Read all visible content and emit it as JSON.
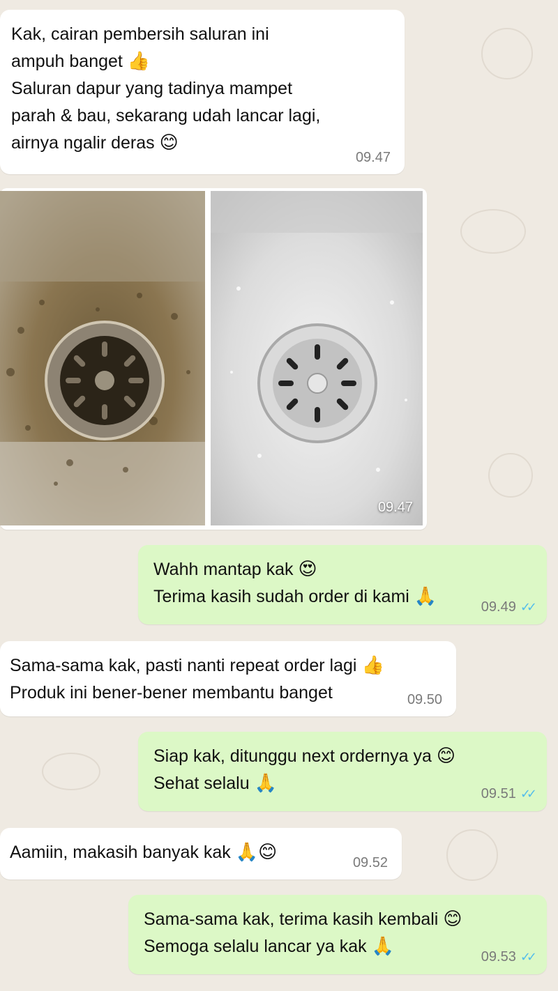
{
  "conversation": {
    "messages": [
      {
        "direction": "incoming",
        "lines": [
          {
            "text": "Kak, cairan pembersih saluran ini",
            "emoji": ""
          },
          {
            "text": "ampuh banget",
            "emoji": "👍"
          },
          {
            "text": "Saluran dapur yang tadinya mampet",
            "emoji": ""
          },
          {
            "text": "parah & bau, sekarang udah lancar lagi,",
            "emoji": ""
          },
          {
            "text": "airnya ngalir deras",
            "emoji": "😊"
          }
        ],
        "time": "09.47"
      },
      {
        "direction": "incoming",
        "type": "image",
        "images": [
          "dirty-sink-drain",
          "clean-sink-drain"
        ],
        "time": "09.47"
      },
      {
        "direction": "outgoing",
        "lines": [
          {
            "text": "Wahh mantap kak",
            "emoji": "😍"
          },
          {
            "text": "Terima kasih sudah order di kami",
            "emoji": "🙏"
          }
        ],
        "time": "09.49",
        "status": "read",
        "status_icon": "double-check-icon"
      },
      {
        "direction": "incoming",
        "lines": [
          {
            "text": "Sama-sama kak, pasti nanti repeat order lagi",
            "emoji": "👍"
          },
          {
            "text": "Produk ini bener-bener membantu banget",
            "emoji": ""
          }
        ],
        "time": "09.50"
      },
      {
        "direction": "outgoing",
        "lines": [
          {
            "text": "Siap kak, ditunggu next ordernya ya",
            "emoji": "😊"
          },
          {
            "text": "Sehat selalu",
            "emoji": "🙏"
          }
        ],
        "time": "09.51",
        "status": "read",
        "status_icon": "double-check-icon"
      },
      {
        "direction": "incoming",
        "lines": [
          {
            "text": "Aamiin, makasih banyak kak",
            "emoji": "🙏😊"
          }
        ],
        "time": "09.52"
      },
      {
        "direction": "outgoing",
        "lines": [
          {
            "text": "Sama-sama kak, terima kasih kembali",
            "emoji": "😊"
          },
          {
            "text": "Semoga selalu lancar ya kak",
            "emoji": "🙏"
          }
        ],
        "time": "09.53",
        "status": "read",
        "status_icon": "double-check-icon"
      }
    ]
  },
  "colors": {
    "background": "#efeae2",
    "incoming_bubble": "#ffffff",
    "outgoing_bubble": "#dcf8c6",
    "read_ticks": "#53bdeb",
    "timestamp": "#7a7a7a"
  }
}
